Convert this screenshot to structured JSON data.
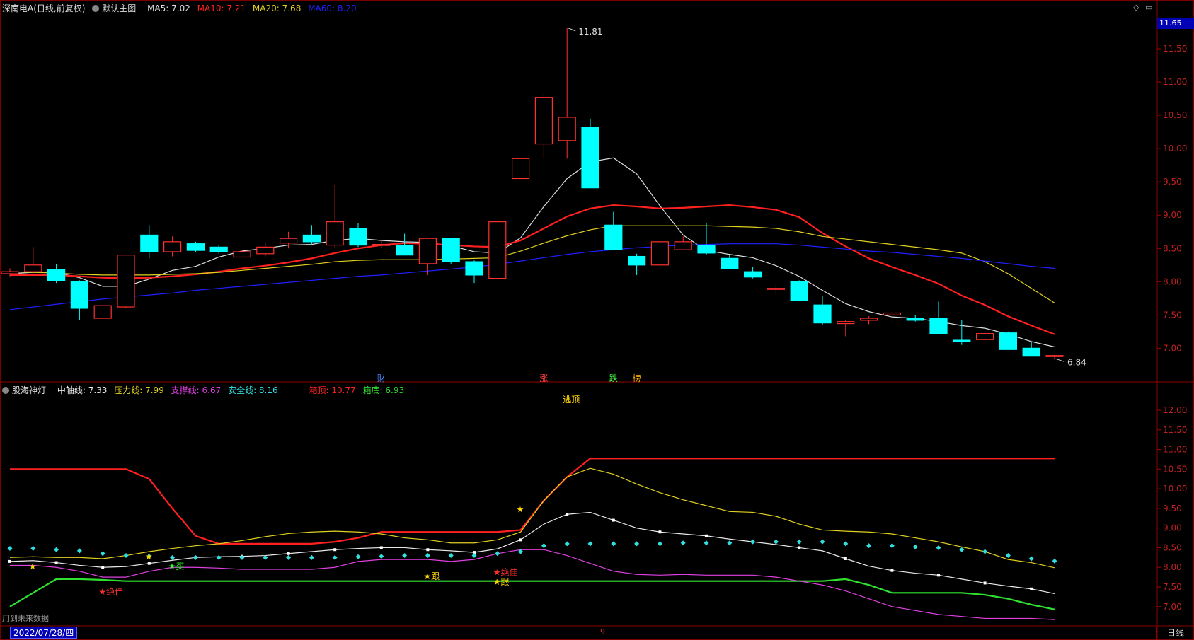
{
  "main_panel": {
    "stock_name": "深南电A(日线,前复权)",
    "template": "默认主图",
    "ma5": {
      "label": "MA5: 7.02",
      "color": "#dddddd"
    },
    "ma10": {
      "label": "MA10: 7.21",
      "color": "#ff2020"
    },
    "ma20": {
      "label": "MA20: 7.68",
      "color": "#e0d020"
    },
    "ma60": {
      "label": "MA60: 8.20",
      "color": "#2020ff"
    },
    "current_price_tag": "11.65",
    "high_label": "11.81",
    "low_label": "6.84",
    "event_markers": [
      {
        "label": "财",
        "color": "#4f8cff",
        "index": 16
      },
      {
        "label": "涨",
        "color": "#ff4040",
        "index": 23
      },
      {
        "label": "跌",
        "color": "#40ff40",
        "index": 26
      },
      {
        "label": "榜",
        "color": "#ffb000",
        "index": 27
      }
    ]
  },
  "indicator_panel": {
    "name": "股海神灯",
    "zhongzhou": {
      "label": "中轴线: 7.33",
      "color": "#e8e8e8"
    },
    "yali": {
      "label": "压力线: 7.99",
      "color": "#e0d020"
    },
    "zhicheng": {
      "label": "支撑线: 6.67",
      "color": "#e040e0"
    },
    "anquan": {
      "label": "安全线: 8.16",
      "color": "#30e0e0"
    },
    "xiangding": {
      "label": "箱顶: 10.77",
      "color": "#ff2020"
    },
    "xiangdi": {
      "label": "箱底: 6.93",
      "color": "#30e030"
    },
    "signals": [
      {
        "text": "逃顶",
        "color": "#ffd700",
        "index": 24,
        "value": 12.2
      },
      {
        "text": "★",
        "color": "#ffd700",
        "index": 1,
        "value": 7.95
      },
      {
        "text": "★绝佳",
        "color": "#ff3030",
        "index": 4,
        "value": 7.3
      },
      {
        "text": "★",
        "color": "#ffd700",
        "index": 6,
        "value": 8.2
      },
      {
        "text": "★买",
        "color": "#30ff30",
        "index": 7,
        "value": 7.95
      },
      {
        "text": "★跟",
        "color": "#ffd700",
        "index": 18,
        "value": 7.7
      },
      {
        "text": "★",
        "color": "#ffd700",
        "index": 22,
        "value": 9.4
      },
      {
        "text": "★绝佳",
        "color": "#ff3030",
        "index": 21,
        "value": 7.8
      },
      {
        "text": "★跟",
        "color": "#ffd700",
        "index": 21,
        "value": 7.55
      }
    ]
  },
  "footer": {
    "date": "2022/07/28/四",
    "period": "日线",
    "note": "用到未来数据",
    "tick_mark": "9"
  },
  "chart_data": [
    {
      "type": "candlestick",
      "title": "深南电A(日线,前复权)",
      "ylim": [
        6.6,
        12.0
      ],
      "y_ticks": [
        7.0,
        7.5,
        8.0,
        8.5,
        9.0,
        9.5,
        10.0,
        10.5,
        11.0,
        11.5
      ],
      "candles": [
        {
          "o": 8.12,
          "h": 8.2,
          "l": 8.08,
          "c": 8.15
        },
        {
          "o": 8.15,
          "h": 8.52,
          "l": 8.1,
          "c": 8.25
        },
        {
          "o": 8.18,
          "h": 8.26,
          "l": 7.98,
          "c": 8.02
        },
        {
          "o": 8.0,
          "h": 8.02,
          "l": 7.42,
          "c": 7.6
        },
        {
          "o": 7.45,
          "h": 7.65,
          "l": 7.45,
          "c": 7.64
        },
        {
          "o": 7.62,
          "h": 8.4,
          "l": 7.6,
          "c": 8.4
        },
        {
          "o": 8.7,
          "h": 8.85,
          "l": 8.35,
          "c": 8.45
        },
        {
          "o": 8.45,
          "h": 8.68,
          "l": 8.38,
          "c": 8.6
        },
        {
          "o": 8.57,
          "h": 8.6,
          "l": 8.45,
          "c": 8.47
        },
        {
          "o": 8.52,
          "h": 8.55,
          "l": 8.42,
          "c": 8.45
        },
        {
          "o": 8.37,
          "h": 8.48,
          "l": 8.37,
          "c": 8.45
        },
        {
          "o": 8.42,
          "h": 8.58,
          "l": 8.38,
          "c": 8.52
        },
        {
          "o": 8.58,
          "h": 8.75,
          "l": 8.5,
          "c": 8.65
        },
        {
          "o": 8.7,
          "h": 8.85,
          "l": 8.55,
          "c": 8.6
        },
        {
          "o": 8.55,
          "h": 9.45,
          "l": 8.5,
          "c": 8.9
        },
        {
          "o": 8.8,
          "h": 8.88,
          "l": 8.52,
          "c": 8.55
        },
        {
          "o": 8.55,
          "h": 8.62,
          "l": 8.5,
          "c": 8.56
        },
        {
          "o": 8.55,
          "h": 8.72,
          "l": 8.4,
          "c": 8.4
        },
        {
          "o": 8.27,
          "h": 8.65,
          "l": 8.1,
          "c": 8.65
        },
        {
          "o": 8.65,
          "h": 8.65,
          "l": 8.27,
          "c": 8.3
        },
        {
          "o": 8.3,
          "h": 8.32,
          "l": 7.98,
          "c": 8.1
        },
        {
          "o": 8.05,
          "h": 8.9,
          "l": 8.05,
          "c": 8.9
        },
        {
          "o": 9.55,
          "h": 9.85,
          "l": 9.55,
          "c": 9.85
        },
        {
          "o": 10.07,
          "h": 10.82,
          "l": 9.85,
          "c": 10.77
        },
        {
          "o": 10.12,
          "h": 11.81,
          "l": 9.85,
          "c": 10.47
        },
        {
          "o": 10.32,
          "h": 10.45,
          "l": 9.41,
          "c": 9.41
        },
        {
          "o": 8.85,
          "h": 9.05,
          "l": 8.47,
          "c": 8.48
        },
        {
          "o": 8.38,
          "h": 8.42,
          "l": 8.1,
          "c": 8.25
        },
        {
          "o": 8.25,
          "h": 8.62,
          "l": 8.2,
          "c": 8.6
        },
        {
          "o": 8.48,
          "h": 8.68,
          "l": 8.48,
          "c": 8.6
        },
        {
          "o": 8.55,
          "h": 8.88,
          "l": 8.4,
          "c": 8.43
        },
        {
          "o": 8.35,
          "h": 8.4,
          "l": 8.2,
          "c": 8.2
        },
        {
          "o": 8.15,
          "h": 8.22,
          "l": 8.05,
          "c": 8.07
        },
        {
          "o": 7.9,
          "h": 7.95,
          "l": 7.8,
          "c": 7.9
        },
        {
          "o": 8.0,
          "h": 8.02,
          "l": 7.72,
          "c": 7.72
        },
        {
          "o": 7.65,
          "h": 7.78,
          "l": 7.35,
          "c": 7.38
        },
        {
          "o": 7.37,
          "h": 7.42,
          "l": 7.18,
          "c": 7.4
        },
        {
          "o": 7.42,
          "h": 7.48,
          "l": 7.36,
          "c": 7.45
        },
        {
          "o": 7.5,
          "h": 7.55,
          "l": 7.4,
          "c": 7.53
        },
        {
          "o": 7.45,
          "h": 7.5,
          "l": 7.4,
          "c": 7.42
        },
        {
          "o": 7.45,
          "h": 7.7,
          "l": 7.22,
          "c": 7.22
        },
        {
          "o": 7.12,
          "h": 7.42,
          "l": 7.05,
          "c": 7.1
        },
        {
          "o": 7.13,
          "h": 7.25,
          "l": 7.05,
          "c": 7.22
        },
        {
          "o": 7.23,
          "h": 7.25,
          "l": 6.98,
          "c": 6.98
        },
        {
          "o": 7.0,
          "h": 7.1,
          "l": 6.88,
          "c": 6.88
        },
        {
          "o": 6.89,
          "h": 6.9,
          "l": 6.84,
          "c": 6.89
        }
      ],
      "series": [
        {
          "name": "MA5",
          "values": [
            8.12,
            8.14,
            8.14,
            8.06,
            7.93,
            7.93,
            8.04,
            8.17,
            8.23,
            8.37,
            8.46,
            8.5,
            8.55,
            8.56,
            8.62,
            8.65,
            8.62,
            8.6,
            8.59,
            8.54,
            8.45,
            8.43,
            8.66,
            9.13,
            9.55,
            9.8,
            9.86,
            9.62,
            9.14,
            8.7,
            8.47,
            8.41,
            8.36,
            8.24,
            8.08,
            7.87,
            7.67,
            7.55,
            7.47,
            7.45,
            7.4,
            7.34,
            7.3,
            7.21,
            7.1,
            7.02
          ]
        },
        {
          "name": "MA10",
          "values": [
            8.1,
            8.1,
            8.1,
            8.08,
            8.06,
            8.05,
            8.06,
            8.08,
            8.11,
            8.15,
            8.2,
            8.24,
            8.29,
            8.35,
            8.43,
            8.5,
            8.55,
            8.58,
            8.57,
            8.55,
            8.53,
            8.52,
            8.62,
            8.8,
            8.98,
            9.1,
            9.15,
            9.13,
            9.1,
            9.11,
            9.13,
            9.15,
            9.12,
            9.08,
            8.97,
            8.73,
            8.53,
            8.35,
            8.22,
            8.1,
            7.97,
            7.79,
            7.65,
            7.48,
            7.34,
            7.21
          ]
        },
        {
          "name": "MA20",
          "values": [
            8.15,
            8.14,
            8.13,
            8.11,
            8.1,
            8.1,
            8.1,
            8.11,
            8.12,
            8.14,
            8.17,
            8.2,
            8.23,
            8.26,
            8.3,
            8.32,
            8.33,
            8.33,
            8.33,
            8.34,
            8.35,
            8.36,
            8.46,
            8.58,
            8.69,
            8.78,
            8.84,
            8.84,
            8.84,
            8.84,
            8.84,
            8.83,
            8.82,
            8.8,
            8.75,
            8.68,
            8.64,
            8.6,
            8.56,
            8.52,
            8.48,
            8.43,
            8.3,
            8.12,
            7.9,
            7.68
          ]
        },
        {
          "name": "MA60",
          "values": [
            7.58,
            7.62,
            7.66,
            7.7,
            7.74,
            7.77,
            7.8,
            7.83,
            7.87,
            7.9,
            7.93,
            7.96,
            7.99,
            8.02,
            8.05,
            8.08,
            8.1,
            8.13,
            8.16,
            8.19,
            8.22,
            8.26,
            8.31,
            8.36,
            8.41,
            8.45,
            8.48,
            8.51,
            8.53,
            8.55,
            8.56,
            8.57,
            8.57,
            8.57,
            8.55,
            8.52,
            8.49,
            8.46,
            8.44,
            8.41,
            8.38,
            8.35,
            8.31,
            8.27,
            8.23,
            8.2
          ]
        }
      ]
    },
    {
      "type": "line",
      "title": "股海神灯",
      "ylim": [
        6.6,
        12.45
      ],
      "y_ticks": [
        7.0,
        7.5,
        8.0,
        8.5,
        9.0,
        9.5,
        10.0,
        10.5,
        11.0,
        11.5,
        12.0
      ],
      "series": [
        {
          "name": "箱顶",
          "values": [
            10.5,
            10.5,
            10.5,
            10.5,
            10.5,
            10.5,
            10.25,
            9.5,
            8.8,
            8.6,
            8.6,
            8.6,
            8.6,
            8.6,
            8.65,
            8.75,
            8.9,
            8.9,
            8.9,
            8.9,
            8.9,
            8.9,
            8.95,
            9.7,
            10.3,
            10.77,
            10.77,
            10.77,
            10.77,
            10.77,
            10.77,
            10.77,
            10.77,
            10.77,
            10.77,
            10.77,
            10.77,
            10.77,
            10.77,
            10.77,
            10.77,
            10.77,
            10.77,
            10.77,
            10.77,
            10.77
          ]
        },
        {
          "name": "箱底",
          "values": [
            7.0,
            7.35,
            7.7,
            7.7,
            7.68,
            7.65,
            7.65,
            7.65,
            7.65,
            7.65,
            7.65,
            7.65,
            7.65,
            7.65,
            7.65,
            7.65,
            7.65,
            7.65,
            7.65,
            7.65,
            7.65,
            7.65,
            7.65,
            7.65,
            7.65,
            7.65,
            7.65,
            7.65,
            7.65,
            7.65,
            7.65,
            7.65,
            7.65,
            7.65,
            7.65,
            7.65,
            7.7,
            7.55,
            7.35,
            7.35,
            7.35,
            7.35,
            7.3,
            7.2,
            7.05,
            6.93
          ]
        },
        {
          "name": "压力线",
          "values": [
            8.25,
            8.27,
            8.25,
            8.25,
            8.22,
            8.3,
            8.4,
            8.48,
            8.55,
            8.6,
            8.68,
            8.78,
            8.86,
            8.9,
            8.92,
            8.9,
            8.85,
            8.75,
            8.7,
            8.62,
            8.62,
            8.7,
            8.9,
            9.7,
            10.3,
            10.52,
            10.37,
            10.12,
            9.9,
            9.72,
            9.57,
            9.42,
            9.4,
            9.3,
            9.1,
            8.95,
            8.92,
            8.9,
            8.85,
            8.75,
            8.65,
            8.52,
            8.4,
            8.2,
            8.12,
            7.99
          ]
        },
        {
          "name": "中轴线",
          "values": [
            8.15,
            8.17,
            8.12,
            8.05,
            8.0,
            8.02,
            8.1,
            8.18,
            8.25,
            8.27,
            8.28,
            8.3,
            8.35,
            8.4,
            8.45,
            8.48,
            8.5,
            8.5,
            8.45,
            8.42,
            8.38,
            8.47,
            8.7,
            9.1,
            9.35,
            9.4,
            9.2,
            9.0,
            8.9,
            8.85,
            8.8,
            8.72,
            8.65,
            8.58,
            8.5,
            8.42,
            8.22,
            8.03,
            7.92,
            7.85,
            7.8,
            7.7,
            7.6,
            7.52,
            7.45,
            7.33
          ]
        },
        {
          "name": "支撑线",
          "values": [
            8.05,
            8.05,
            8.0,
            7.9,
            7.75,
            7.75,
            7.9,
            8.0,
            8.0,
            7.98,
            7.95,
            7.95,
            7.95,
            7.95,
            8.0,
            8.15,
            8.2,
            8.2,
            8.2,
            8.15,
            8.2,
            8.35,
            8.45,
            8.45,
            8.3,
            8.1,
            7.9,
            7.82,
            7.8,
            7.82,
            7.8,
            7.8,
            7.8,
            7.75,
            7.65,
            7.55,
            7.4,
            7.2,
            7.0,
            6.9,
            6.8,
            6.75,
            6.7,
            6.7,
            6.7,
            6.67
          ]
        },
        {
          "name": "安全线",
          "values": [
            8.48,
            8.48,
            8.45,
            8.42,
            8.35,
            8.3,
            8.28,
            8.25,
            8.25,
            8.25,
            8.25,
            8.25,
            8.25,
            8.25,
            8.25,
            8.27,
            8.28,
            8.3,
            8.3,
            8.3,
            8.3,
            8.35,
            8.4,
            8.55,
            8.6,
            8.6,
            8.6,
            8.6,
            8.6,
            8.62,
            8.62,
            8.62,
            8.65,
            8.65,
            8.65,
            8.65,
            8.6,
            8.55,
            8.55,
            8.52,
            8.5,
            8.45,
            8.4,
            8.3,
            8.22,
            8.16
          ]
        }
      ]
    }
  ]
}
